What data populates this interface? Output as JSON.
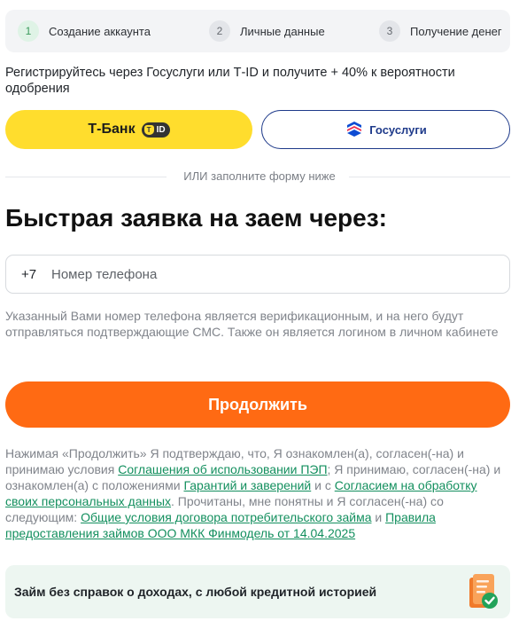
{
  "steps": [
    {
      "num": "1",
      "label": "Создание аккаунта",
      "active": true
    },
    {
      "num": "2",
      "label": "Личные данные",
      "active": false
    },
    {
      "num": "3",
      "label": "Получение денег",
      "active": false
    }
  ],
  "intro": "Регистрируйтесь через Госуслуги или Т-ID и получите + 40% к вероятности одобрения",
  "tbank_button": {
    "label": "Т-Банк",
    "badge": "ID",
    "color": "#ffdd2d"
  },
  "gosuslugi_button": {
    "label": "Госуслуги"
  },
  "divider_text": "ИЛИ заполните форму ниже",
  "form_title": "Быстрая заявка на заем через:",
  "phone": {
    "prefix": "+7",
    "placeholder": "Номер телефона",
    "value": ""
  },
  "hint": "Указанный Вами номер телефона является верификационным, и на него будут отправляться подтверждающие СМС. Также он является логином в личном кабинете",
  "continue_button": {
    "label": "Продолжить",
    "color": "#ff6a13"
  },
  "terms": {
    "t1": "Нажимая «Продолжить» Я подтверждаю, что, Я ознакомлен(а), согласен(-на) и принимаю условия ",
    "link1": "Соглашения об использовании ПЭП",
    "t2": "; Я принимаю, согласен(-на) и ознакомлен(а) с положениями ",
    "link2": "Гарантий и заверений",
    "t3": " и с ",
    "link3": "Согласием на обработку своих персональных данных",
    "t4": ". Прочитаны, мне понятны и Я согласен(-на) со следующим: ",
    "link4": "Общие условия договора потребительского займа",
    "t5": " и ",
    "link5": "Правила предоставления займов ООО МКК Финмодель от 14.04.2025",
    "link_color": "#138f5e"
  },
  "promo": {
    "text": "Займ без справок о доходах, с любой кредитной историей",
    "icon": "approved-document-icon"
  }
}
